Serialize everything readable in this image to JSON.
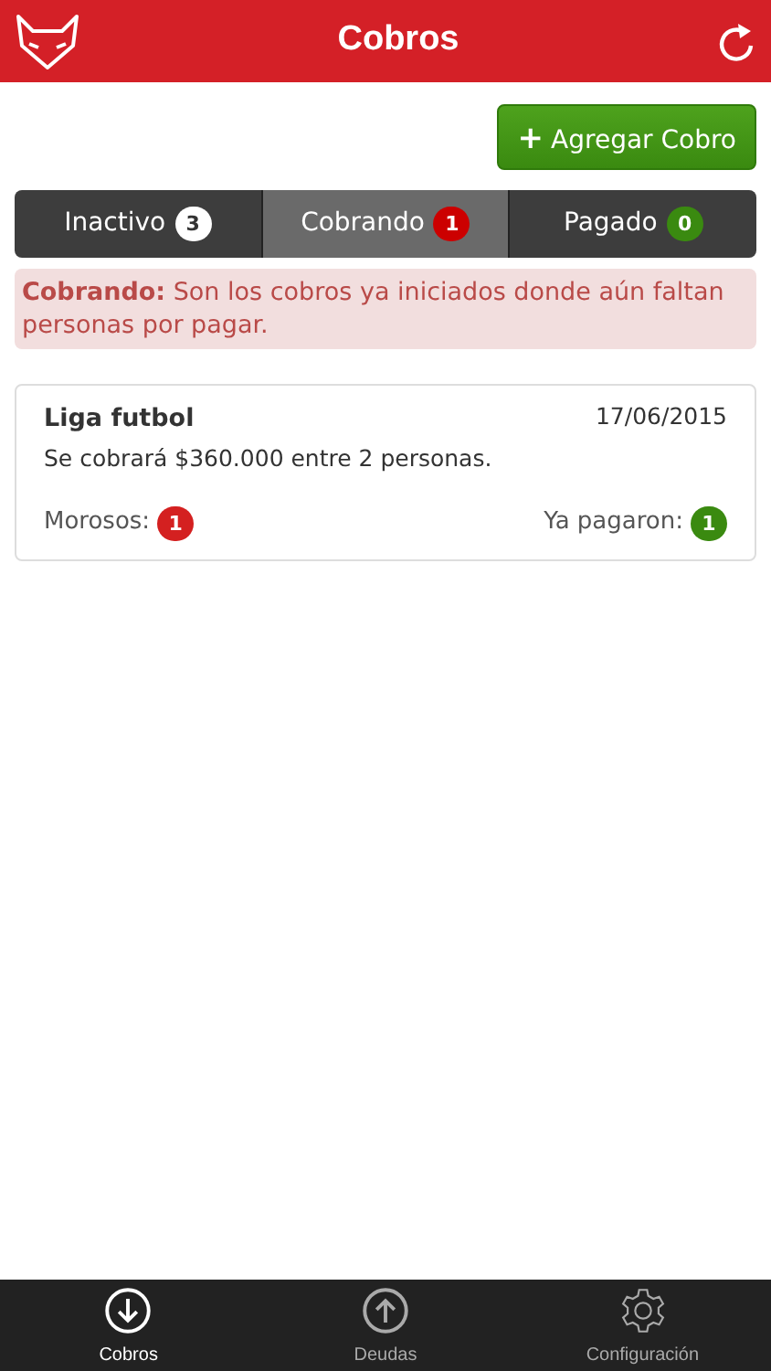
{
  "header": {
    "title": "Cobros"
  },
  "add_button": {
    "label": "Agregar Cobro",
    "icon": "+"
  },
  "tabs": [
    {
      "label": "Inactivo",
      "count": "3",
      "color": "#ffffff",
      "selected": false
    },
    {
      "label": "Cobrando",
      "count": "1",
      "color": "#cc0000",
      "selected": true
    },
    {
      "label": "Pagado",
      "count": "0",
      "color": "#3a8a10",
      "selected": false
    }
  ],
  "notice": "**Cobrando:** Son los cobros ya iniciados donde aún faltan personas por pagar.",
  "items": [
    {
      "title": "Liga futbol",
      "date": "17/06/2015",
      "description": "Se cobrará $360.000 entre 2 personas.",
      "stats": [
        {
          "label": "Morosos:",
          "count": "1",
          "color": "#d42020"
        },
        {
          "label": "Ya pagaron:",
          "count": "1",
          "color": "#3a8a10"
        }
      ]
    }
  ],
  "bottom_tabs": [
    {
      "label": "Cobros",
      "kind": "down",
      "selected": true
    },
    {
      "label": "Deudas",
      "kind": "up",
      "selected": false
    },
    {
      "label": "Configuración",
      "kind": "gear",
      "selected": false
    }
  ]
}
